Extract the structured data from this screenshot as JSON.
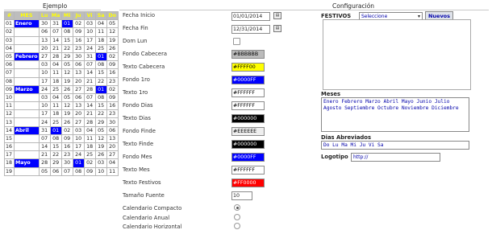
{
  "headers": {
    "ejemplo": "Ejemplo",
    "configuracion": "Configuración"
  },
  "calendar": {
    "head": [
      "#",
      "MES",
      "Lu",
      "Ma",
      "Mi",
      "Ju",
      "Vi",
      "Sa",
      "Do"
    ],
    "rows": [
      {
        "wk": "01",
        "mes": "Enero",
        "days": [
          "30",
          "31",
          "01",
          "02",
          "03",
          "04",
          "05"
        ],
        "hl": {
          "mon": true,
          "fes": [
            2
          ],
          "fin": []
        }
      },
      {
        "wk": "02",
        "mes": "",
        "days": [
          "06",
          "07",
          "08",
          "09",
          "10",
          "11",
          "12"
        ],
        "hl": {
          "fes": [],
          "fin": []
        }
      },
      {
        "wk": "03",
        "mes": "",
        "days": [
          "13",
          "14",
          "15",
          "16",
          "17",
          "18",
          "19"
        ],
        "hl": {
          "fes": [],
          "fin": []
        }
      },
      {
        "wk": "04",
        "mes": "",
        "days": [
          "20",
          "21",
          "22",
          "23",
          "24",
          "25",
          "26"
        ],
        "hl": {
          "fes": [],
          "fin": []
        }
      },
      {
        "wk": "05",
        "mes": "Febrero",
        "days": [
          "27",
          "28",
          "29",
          "30",
          "31",
          "01",
          "02"
        ],
        "hl": {
          "mon": true,
          "fes": [
            5
          ],
          "fin": []
        }
      },
      {
        "wk": "06",
        "mes": "",
        "days": [
          "03",
          "04",
          "05",
          "06",
          "07",
          "08",
          "09"
        ],
        "hl": {
          "fes": [],
          "fin": []
        }
      },
      {
        "wk": "07",
        "mes": "",
        "days": [
          "10",
          "11",
          "12",
          "13",
          "14",
          "15",
          "16"
        ],
        "hl": {
          "fes": [],
          "fin": []
        }
      },
      {
        "wk": "08",
        "mes": "",
        "days": [
          "17",
          "18",
          "19",
          "20",
          "21",
          "22",
          "23"
        ],
        "hl": {
          "fes": [],
          "fin": []
        }
      },
      {
        "wk": "09",
        "mes": "Marzo",
        "days": [
          "24",
          "25",
          "26",
          "27",
          "28",
          "01",
          "02"
        ],
        "hl": {
          "mon": true,
          "fes": [
            5
          ],
          "fin": []
        }
      },
      {
        "wk": "10",
        "mes": "",
        "days": [
          "03",
          "04",
          "05",
          "06",
          "07",
          "08",
          "09"
        ],
        "hl": {
          "fes": [],
          "fin": []
        }
      },
      {
        "wk": "11",
        "mes": "",
        "days": [
          "10",
          "11",
          "12",
          "13",
          "14",
          "15",
          "16"
        ],
        "hl": {
          "fes": [],
          "fin": []
        }
      },
      {
        "wk": "12",
        "mes": "",
        "days": [
          "17",
          "18",
          "19",
          "20",
          "21",
          "22",
          "23"
        ],
        "hl": {
          "fes": [],
          "fin": []
        }
      },
      {
        "wk": "13",
        "mes": "",
        "days": [
          "24",
          "25",
          "26",
          "27",
          "28",
          "29",
          "30"
        ],
        "hl": {
          "fes": [],
          "fin": []
        }
      },
      {
        "wk": "14",
        "mes": "Abril",
        "days": [
          "31",
          "01",
          "02",
          "03",
          "04",
          "05",
          "06"
        ],
        "hl": {
          "mon": true,
          "fes": [
            1
          ],
          "fin": []
        }
      },
      {
        "wk": "15",
        "mes": "",
        "days": [
          "07",
          "08",
          "09",
          "10",
          "11",
          "12",
          "13"
        ],
        "hl": {
          "fes": [],
          "fin": []
        }
      },
      {
        "wk": "16",
        "mes": "",
        "days": [
          "14",
          "15",
          "16",
          "17",
          "18",
          "19",
          "20"
        ],
        "hl": {
          "fes": [],
          "fin": []
        }
      },
      {
        "wk": "17",
        "mes": "",
        "days": [
          "21",
          "22",
          "23",
          "24",
          "25",
          "26",
          "27"
        ],
        "hl": {
          "fes": [],
          "fin": []
        }
      },
      {
        "wk": "18",
        "mes": "Mayo",
        "days": [
          "28",
          "29",
          "30",
          "01",
          "02",
          "03",
          "04"
        ],
        "hl": {
          "mon": true,
          "fes": [
            3
          ],
          "fin": []
        }
      },
      {
        "wk": "19",
        "mes": "",
        "days": [
          "05",
          "06",
          "07",
          "08",
          "09",
          "10",
          "11"
        ],
        "hl": {
          "fes": [],
          "fin": []
        }
      }
    ]
  },
  "form": {
    "fecha_inicio": {
      "label": "Fecha Inicio",
      "value": "01/01/2014"
    },
    "fecha_fin": {
      "label": "Fecha Fin",
      "value": "12/31/2014"
    },
    "dom_lun": {
      "label": "Dom Lun"
    },
    "fondo_cabecera": {
      "label": "Fondo Cabecera",
      "value": "#BBBBBB",
      "bg": "#bbbbbb",
      "fg": "#000000"
    },
    "texto_cabecera": {
      "label": "Texto Cabecera",
      "value": "#FFFF00",
      "bg": "#ffff00",
      "fg": "#000000"
    },
    "fondo_1ro": {
      "label": "Fondo 1ro",
      "value": "#0000FF",
      "bg": "#0000ff",
      "fg": "#ffffff"
    },
    "texto_1ro": {
      "label": "Texto 1ro",
      "value": "#FFFFFF",
      "bg": "#ffffff",
      "fg": "#000000"
    },
    "fondo_dias": {
      "label": "Fondo Dias",
      "value": "#FFFFFF",
      "bg": "#ffffff",
      "fg": "#000000"
    },
    "texto_dias": {
      "label": "Texto Dias",
      "value": "#000000",
      "bg": "#000000",
      "fg": "#ffffff"
    },
    "fondo_finde": {
      "label": "Fondo Finde",
      "value": "#EEEEEE",
      "bg": "#eeeeee",
      "fg": "#000000"
    },
    "texto_finde": {
      "label": "Texto Finde",
      "value": "#000000",
      "bg": "#000000",
      "fg": "#ffffff"
    },
    "fondo_mes": {
      "label": "Fondo Mes",
      "value": "#0000FF",
      "bg": "#0000ff",
      "fg": "#ffffff"
    },
    "texto_mes": {
      "label": "Texto Mes",
      "value": "#FFFFFF",
      "bg": "#ffffff",
      "fg": "#000000"
    },
    "texto_festivos": {
      "label": "Texto Festivos",
      "value": "#FF0000",
      "bg": "#ff0000",
      "fg": "#ffffff"
    },
    "tamano_fuente": {
      "label": "Tamaño Fuente",
      "value": "10"
    },
    "cal_compacto": {
      "label": "Calendario Compacto"
    },
    "cal_anual": {
      "label": "Calendario Anual"
    },
    "cal_horizontal": {
      "label": "Calendario Horizontal"
    }
  },
  "right": {
    "festivos_label": "FESTIVOS",
    "festivos_select": "Seleccione",
    "nuevos_button": "Nuevos",
    "meses_label": "Meses",
    "meses_value": "Enero Febrero Marzo Abril Mayo Junio Julio Agosto Septiembre Octubre Noviembre Diciembre",
    "dias_label": "Dias Abreviados",
    "dias_value": "Do Lu Ma Mi Ju Vi Sa",
    "logotipo_label": "Logotipo",
    "logotipo_value": "http://"
  },
  "icons": {
    "calendar_picker": "calendar-icon",
    "select_arrow": "chevron-down-icon"
  }
}
